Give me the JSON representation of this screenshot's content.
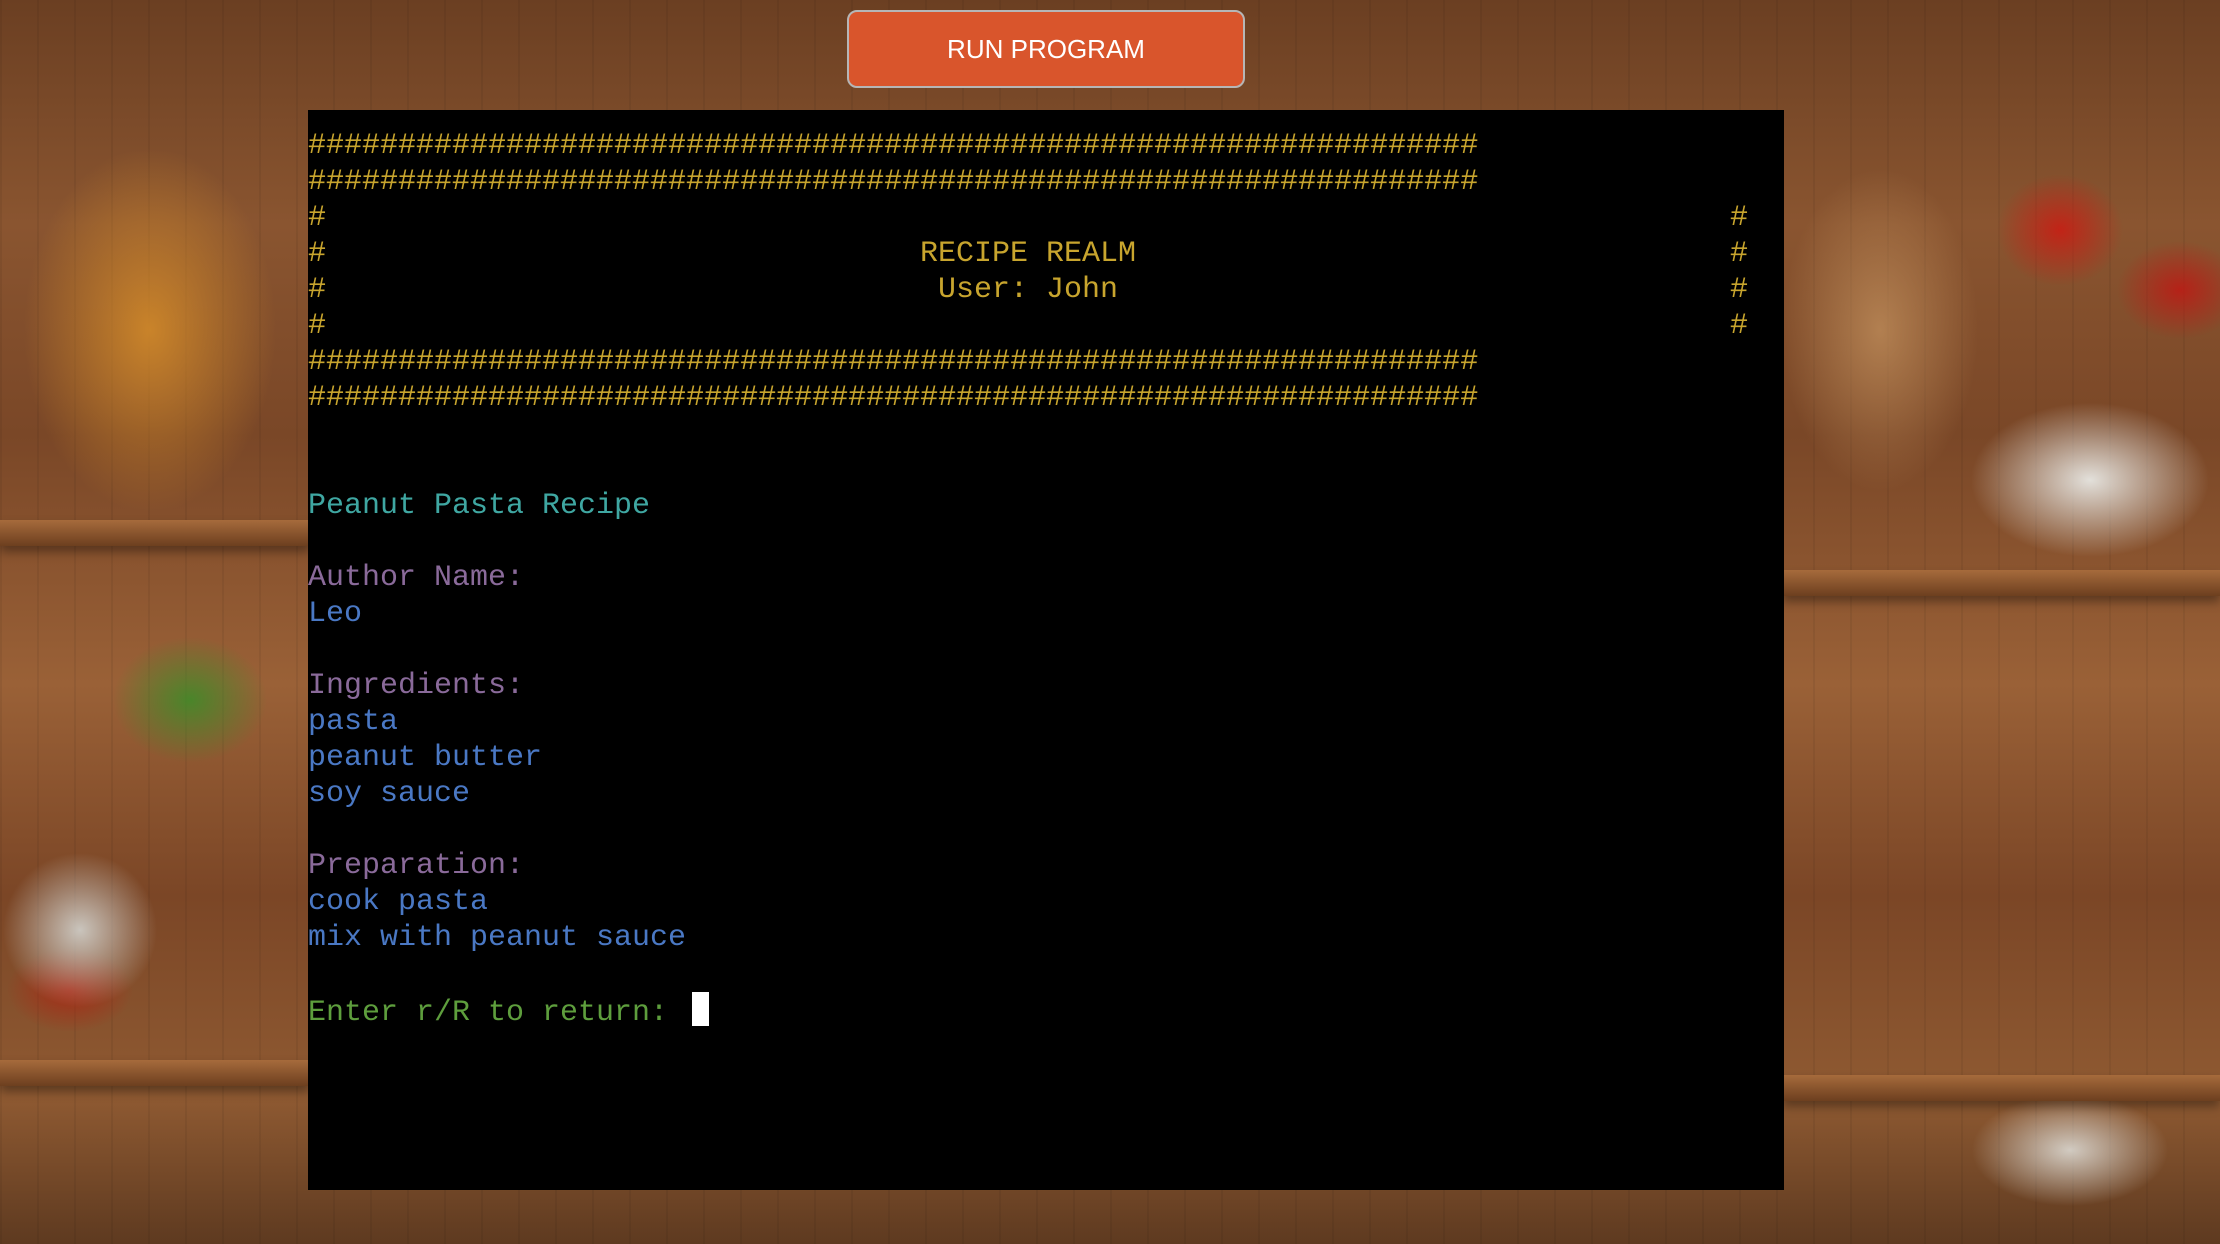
{
  "run_button": {
    "label": "RUN PROGRAM"
  },
  "terminal": {
    "banner": {
      "hash_row": "#################################################################",
      "side_hash": "#",
      "app_title": "RECIPE REALM",
      "user_line": "User: John"
    },
    "recipe": {
      "title": "Peanut Pasta Recipe",
      "author_label": "Author Name:",
      "author_value": "Leo",
      "ingredients_label": "Ingredients:",
      "ingredients": [
        "pasta",
        "peanut butter",
        "soy sauce"
      ],
      "preparation_label": "Preparation:",
      "preparation": [
        "cook pasta",
        "mix with peanut sauce"
      ]
    },
    "prompt": "Enter r/R to return: "
  },
  "colors": {
    "button": "#d9552c",
    "banner": "#c8a52e",
    "title": "#3fa7a2",
    "label": "#8a6a9a",
    "value": "#4a78c4",
    "prompt": "#5e9e3d",
    "terminal_bg": "#000000"
  }
}
